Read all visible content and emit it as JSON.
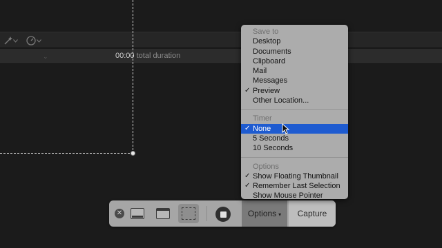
{
  "editor": {
    "toolbar_icons": [
      "magic-wand-icon",
      "chevron-down-icon",
      "speed-gauge-icon",
      "chevron-down-icon"
    ],
    "timecode": "00:00",
    "duration_label": "total duration"
  },
  "capture_bar": {
    "close_icon": "close-icon",
    "modes": [
      "capture-entire-screen",
      "capture-selected-window",
      "capture-selected-portion"
    ],
    "selected_mode": "capture-selected-portion",
    "record_icon": "stop-record-icon",
    "options_label": "Options",
    "capture_label": "Capture"
  },
  "menu": {
    "sections": [
      {
        "header": "Save to",
        "items": [
          {
            "label": "Desktop",
            "checked": false
          },
          {
            "label": "Documents",
            "checked": false
          },
          {
            "label": "Clipboard",
            "checked": false
          },
          {
            "label": "Mail",
            "checked": false
          },
          {
            "label": "Messages",
            "checked": false
          },
          {
            "label": "Preview",
            "checked": true
          },
          {
            "label": "Other Location...",
            "checked": false
          }
        ]
      },
      {
        "header": "Timer",
        "items": [
          {
            "label": "None",
            "checked": true,
            "highlighted": true
          },
          {
            "label": "5 Seconds",
            "checked": false
          },
          {
            "label": "10 Seconds",
            "checked": false
          }
        ]
      },
      {
        "header": "Options",
        "items": [
          {
            "label": "Show Floating Thumbnail",
            "checked": true
          },
          {
            "label": "Remember Last Selection",
            "checked": true
          },
          {
            "label": "Show Mouse Pointer",
            "checked": false
          }
        ]
      }
    ],
    "check_glyph": "✓",
    "highlight_color": "#1e5bd0"
  }
}
